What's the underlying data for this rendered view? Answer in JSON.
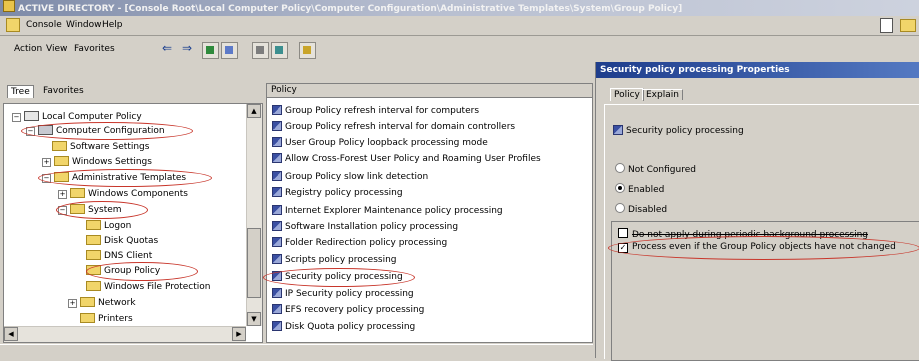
{
  "window": {
    "title": "ACTIVE DIRECTORY - [Console Root\\Local Computer Policy\\Computer Configuration\\Administrative Templates\\System\\Group Policy]"
  },
  "menu": {
    "console": "Console",
    "window": "Window",
    "help": "Help"
  },
  "toolbar": {
    "action": "Action",
    "view": "View",
    "favorites": "Favorites"
  },
  "tree": {
    "tabs": [
      "Tree",
      "Favorites"
    ],
    "items": [
      "Local Computer Policy",
      "Computer Configuration",
      "Software Settings",
      "Windows Settings",
      "Administrative Templates",
      "Windows Components",
      "System",
      "Logon",
      "Disk Quotas",
      "DNS Client",
      "Group Policy",
      "Windows File Protection",
      "Network",
      "Printers"
    ]
  },
  "policy": {
    "header": "Policy",
    "items": [
      "Group Policy refresh interval for computers",
      "Group Policy refresh interval for domain controllers",
      "User Group Policy loopback processing mode",
      "Allow Cross-Forest User Policy and Roaming User Profiles",
      "Group Policy slow link detection",
      "Registry policy processing",
      "Internet Explorer Maintenance policy processing",
      "Software Installation policy processing",
      "Folder Redirection policy processing",
      "Scripts policy processing",
      "Security policy processing",
      "IP Security policy processing",
      "EFS recovery policy processing",
      "Disk Quota policy processing"
    ]
  },
  "dialog": {
    "title": "Security policy processing Properties",
    "tabs": [
      "Policy",
      "Explain"
    ],
    "setting_name": "Security policy processing",
    "radios": [
      "Not Configured",
      "Enabled",
      "Disabled"
    ],
    "selected_radio": "Enabled",
    "checkboxes": [
      {
        "label": "Do not apply during periodic background processing",
        "checked": false
      },
      {
        "label": "Process even if the Group Policy objects have not changed",
        "checked": true
      }
    ]
  }
}
